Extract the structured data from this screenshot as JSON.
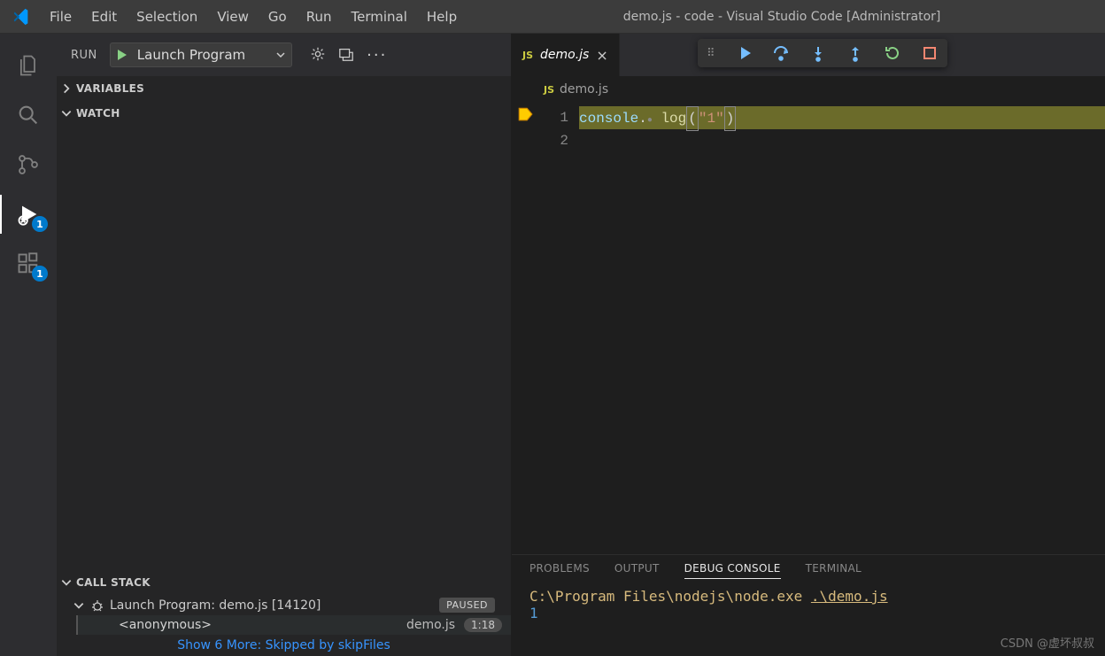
{
  "titlebar": {
    "menu": [
      "File",
      "Edit",
      "Selection",
      "View",
      "Go",
      "Run",
      "Terminal",
      "Help"
    ],
    "title": "demo.js - code - Visual Studio Code [Administrator]"
  },
  "activitybar": {
    "run_badge": "1",
    "extensions_badge": "1"
  },
  "sidebar": {
    "title": "RUN",
    "config": "Launch Program",
    "sections": {
      "variables": "VARIABLES",
      "watch": "WATCH",
      "callstack": "CALL STACK"
    },
    "callstack": {
      "program": "Launch Program: demo.js [14120]",
      "status": "PAUSED",
      "frame_name": "<anonymous>",
      "frame_file": "demo.js",
      "frame_pos": "1:18",
      "more": "Show 6 More: Skipped by skipFiles"
    }
  },
  "editor": {
    "tab_label": "demo.js",
    "breadcrumb_file": "demo.js",
    "line_numbers": [
      "1",
      "2"
    ],
    "code": {
      "obj": "console",
      "dot": ".",
      "prop": "log",
      "open": "(",
      "str": "\"1\"",
      "close": ")"
    }
  },
  "panel": {
    "tabs": [
      "PROBLEMS",
      "OUTPUT",
      "DEBUG CONSOLE",
      "TERMINAL"
    ],
    "active_tab": 2,
    "console_path": "C:\\Program Files\\nodejs\\node.exe ",
    "console_arg": ".\\demo.js",
    "console_output": "1"
  },
  "watermark": "CSDN @虚坏叔叔"
}
